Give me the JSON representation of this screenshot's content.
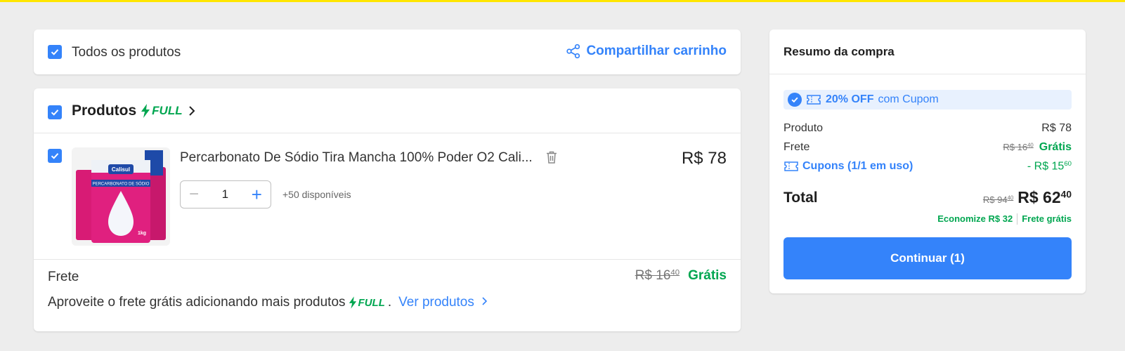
{
  "colors": {
    "accent": "#3483fa",
    "success": "#00a650",
    "brand_bar": "#ffe600"
  },
  "all_products": {
    "label": "Todos os produtos",
    "share_label": "Compartilhar carrinho",
    "share_icon": "share-icon"
  },
  "group": {
    "title": "Produtos",
    "badge": "FULL"
  },
  "item": {
    "name": "Percarbonato De Sódio Tira Mancha 100% Poder O2 Cali...",
    "price": "R$ 78",
    "quantity": "1",
    "available": "+50 disponíveis",
    "thumb_brand": "Calisul",
    "thumb_text": "PERCARBONATO DE SÓDIO",
    "thumb_weight": "1kg"
  },
  "shipping": {
    "label": "Frete",
    "old_price": "R$ 16",
    "old_cents": "40",
    "free": "Grátis",
    "promo_text": "Aproveite o frete grátis adicionando mais produtos",
    "promo_badge": "FULL",
    "promo_sep": ".",
    "promo_link": "Ver produtos"
  },
  "summary": {
    "title": "Resumo da compra",
    "coupon_bold": "20% OFF",
    "coupon_text": "com Cupom",
    "product_label": "Produto",
    "product_value": "R$ 78",
    "ship_label": "Frete",
    "ship_old": "R$ 16",
    "ship_old_cents": "40",
    "ship_free": "Grátis",
    "coupons_label": "Cupons (1/1 em uso)",
    "coupons_value": "- R$ 15",
    "coupons_cents": "60",
    "total_label": "Total",
    "total_old": "R$ 94",
    "total_old_cents": "40",
    "total_value": "R$ 62",
    "total_cents": "40",
    "save_text": "Economize R$ 32",
    "free_ship_text": "Frete grátis",
    "cta": "Continuar (1)"
  }
}
